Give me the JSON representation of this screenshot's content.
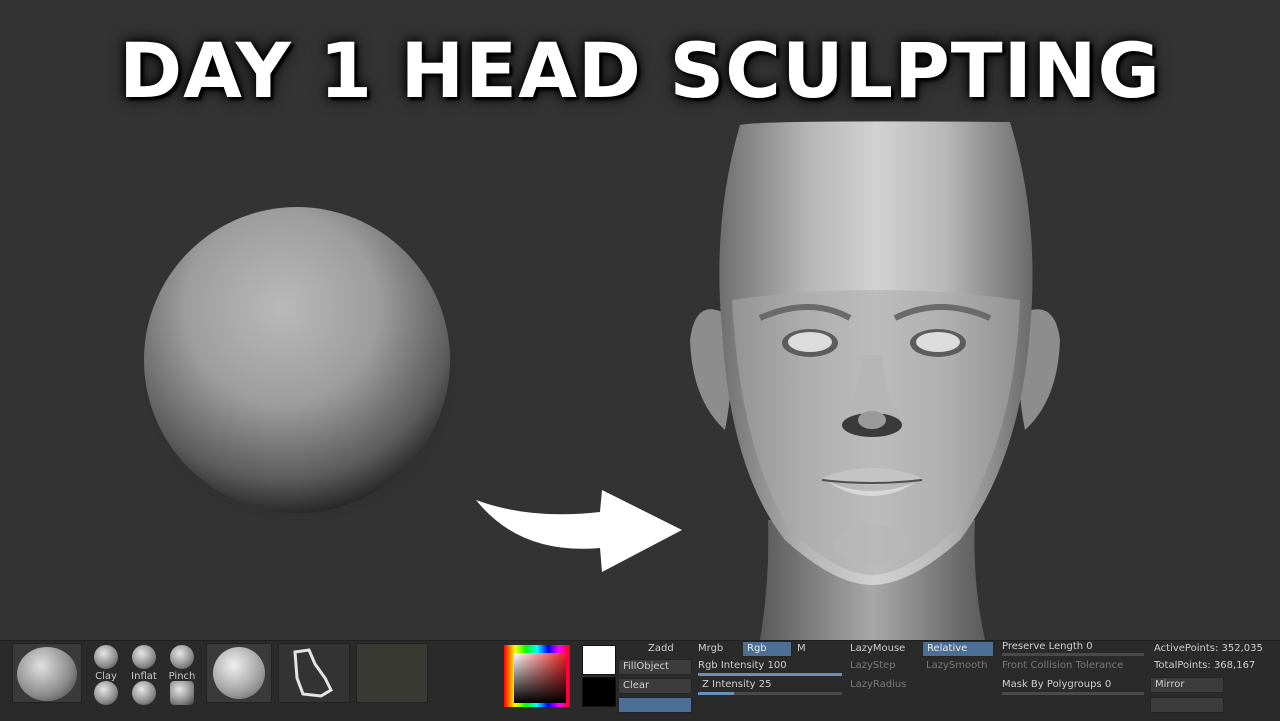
{
  "title": "DAY 1 HEAD SCULPTING",
  "icons": {
    "sphere": "sphere-mesh-icon",
    "head": "head-mesh-icon",
    "arrow": "arrow-right-icon"
  },
  "colors": {
    "background": "#333333",
    "title": "#ffffff",
    "active_button": "#4c6f95"
  },
  "toolbar": {
    "brushes": [
      {
        "label": "Clay"
      },
      {
        "label": "Inflat"
      },
      {
        "label": "Pinch"
      }
    ],
    "color": {
      "zadd": "Zadd",
      "fill_object": "FillObject",
      "clear": "Clear"
    },
    "draw": {
      "mrgb": "Mrgb",
      "rgb": "Rgb",
      "m": "M",
      "rgb_intensity": "Rgb Intensity 100",
      "z_intensity": "Z Intensity 25",
      "z_intensity_value": 25,
      "rgb_intensity_value": 100
    },
    "stroke": {
      "lazy_mouse": "LazyMouse",
      "relative": "Relative",
      "lazy_step": "LazyStep",
      "lazy_smooth": "LazySmooth",
      "lazy_radius": "LazyRadius"
    },
    "topology": {
      "preserve_length": "Preserve Length 0",
      "front_collision": "Front Collision Tolerance",
      "mask_polygroups": "Mask By Polygroups 0"
    },
    "stats": {
      "active_points": "ActivePoints: 352,035",
      "total_points": "TotalPoints: 368,167",
      "mirror": "Mirror"
    }
  }
}
